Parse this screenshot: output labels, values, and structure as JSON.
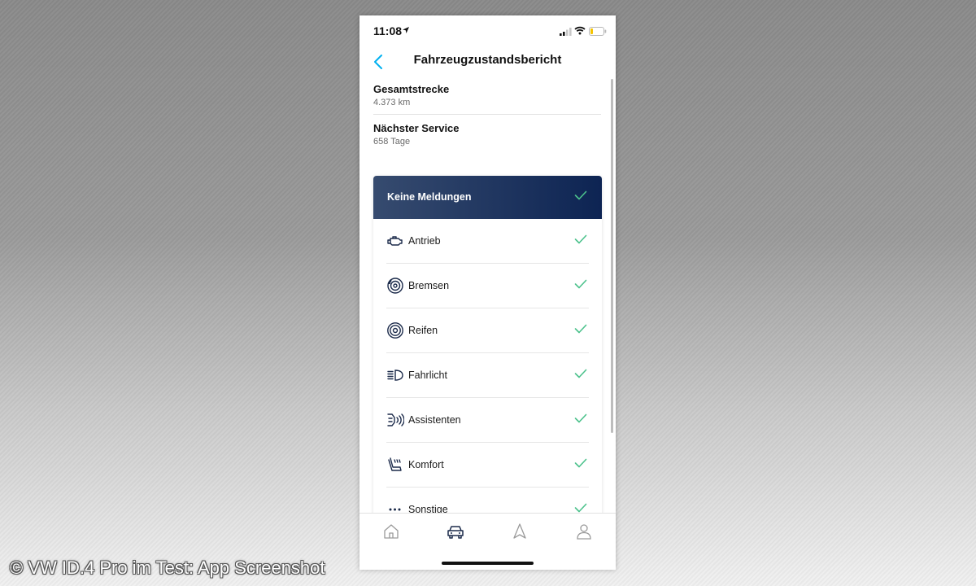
{
  "status_bar": {
    "time": "11:08"
  },
  "nav": {
    "title": "Fahrzeugzustandsbericht"
  },
  "info": [
    {
      "label": "Gesamtstrecke",
      "value": "4.373 km"
    },
    {
      "label": "Nächster Service",
      "value": "658 Tage"
    }
  ],
  "card": {
    "header": "Keine Meldungen",
    "items": [
      {
        "label": "Antrieb",
        "icon": "engine-icon"
      },
      {
        "label": "Bremsen",
        "icon": "brake-disc-icon"
      },
      {
        "label": "Reifen",
        "icon": "tire-icon"
      },
      {
        "label": "Fahrlicht",
        "icon": "headlight-icon"
      },
      {
        "label": "Assistenten",
        "icon": "assist-sensor-icon"
      },
      {
        "label": "Komfort",
        "icon": "seat-icon"
      },
      {
        "label": "Sonstige",
        "icon": "more-dots-icon"
      }
    ]
  },
  "tabs": [
    {
      "name": "Home",
      "icon": "home-icon"
    },
    {
      "name": "Vehicle",
      "icon": "car-icon",
      "active": true
    },
    {
      "name": "Navigation",
      "icon": "navigation-icon"
    },
    {
      "name": "Profile",
      "icon": "profile-icon"
    }
  ],
  "colors": {
    "accent": "#00b0f0",
    "check": "#4cc28c",
    "header_dark": "#0d2453",
    "header_light": "#364b6f",
    "icon_dark": "#1b2a4a",
    "tab_inactive": "#9a9a9a"
  },
  "caption": "© VW ID.4 Pro im Test: App Screenshot"
}
